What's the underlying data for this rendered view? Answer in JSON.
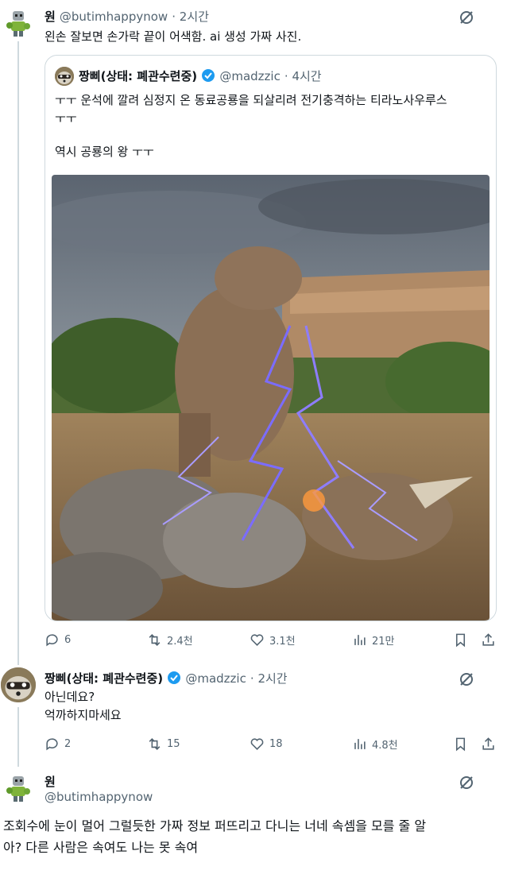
{
  "tweet1": {
    "name": "원",
    "handle": "@butimhappynow",
    "time": "· 2시간",
    "text": "왼손 잘보면 손가락 끝이 어색함. ai 생성 가짜 사진."
  },
  "quoted": {
    "name": "짱삐(상태: 폐관수련중)",
    "handle": "@madzzic",
    "time": "· 4시간",
    "line1": "ㅜㅜ 운석에 깔려 심정지 온 동료공룡을 되살리려 전기충격하는 티라노사우루스",
    "line2": "ㅜㅜ",
    "line3": "역시 공룡의 왕 ㅜㅜ",
    "image_alt": "AI 생성 티라노사우루스 전기충격 이미지"
  },
  "tweet1_actions": {
    "replies": "6",
    "retweets": "2.4천",
    "likes": "3.1천",
    "views": "21만"
  },
  "reply": {
    "name": "짱삐(상태: 폐관수련중)",
    "handle": "@madzzic",
    "time": "· 2시간",
    "line1": "아닌데요?",
    "line2": "억까하지마세요"
  },
  "reply_actions": {
    "replies": "2",
    "retweets": "15",
    "likes": "18",
    "views": "4.8천"
  },
  "tweet3": {
    "name": "원",
    "handle": "@butimhappynow",
    "line1": "조회수에 눈이 멀어 그럴듯한 가짜 정보 퍼뜨리고 다니는 너네 속셈을 모를 줄 알",
    "line2": "아? 다른 사람은 속여도 나는 못 속여"
  },
  "colors": {
    "verified": "#1d9bf0",
    "muted": "#536471",
    "border": "#cfd9de",
    "lightning": "#7b6cff"
  },
  "icons": [
    "reply-icon",
    "retweet-icon",
    "like-icon",
    "views-icon",
    "bookmark-icon",
    "share-icon",
    "grok-icon",
    "verified-icon"
  ]
}
